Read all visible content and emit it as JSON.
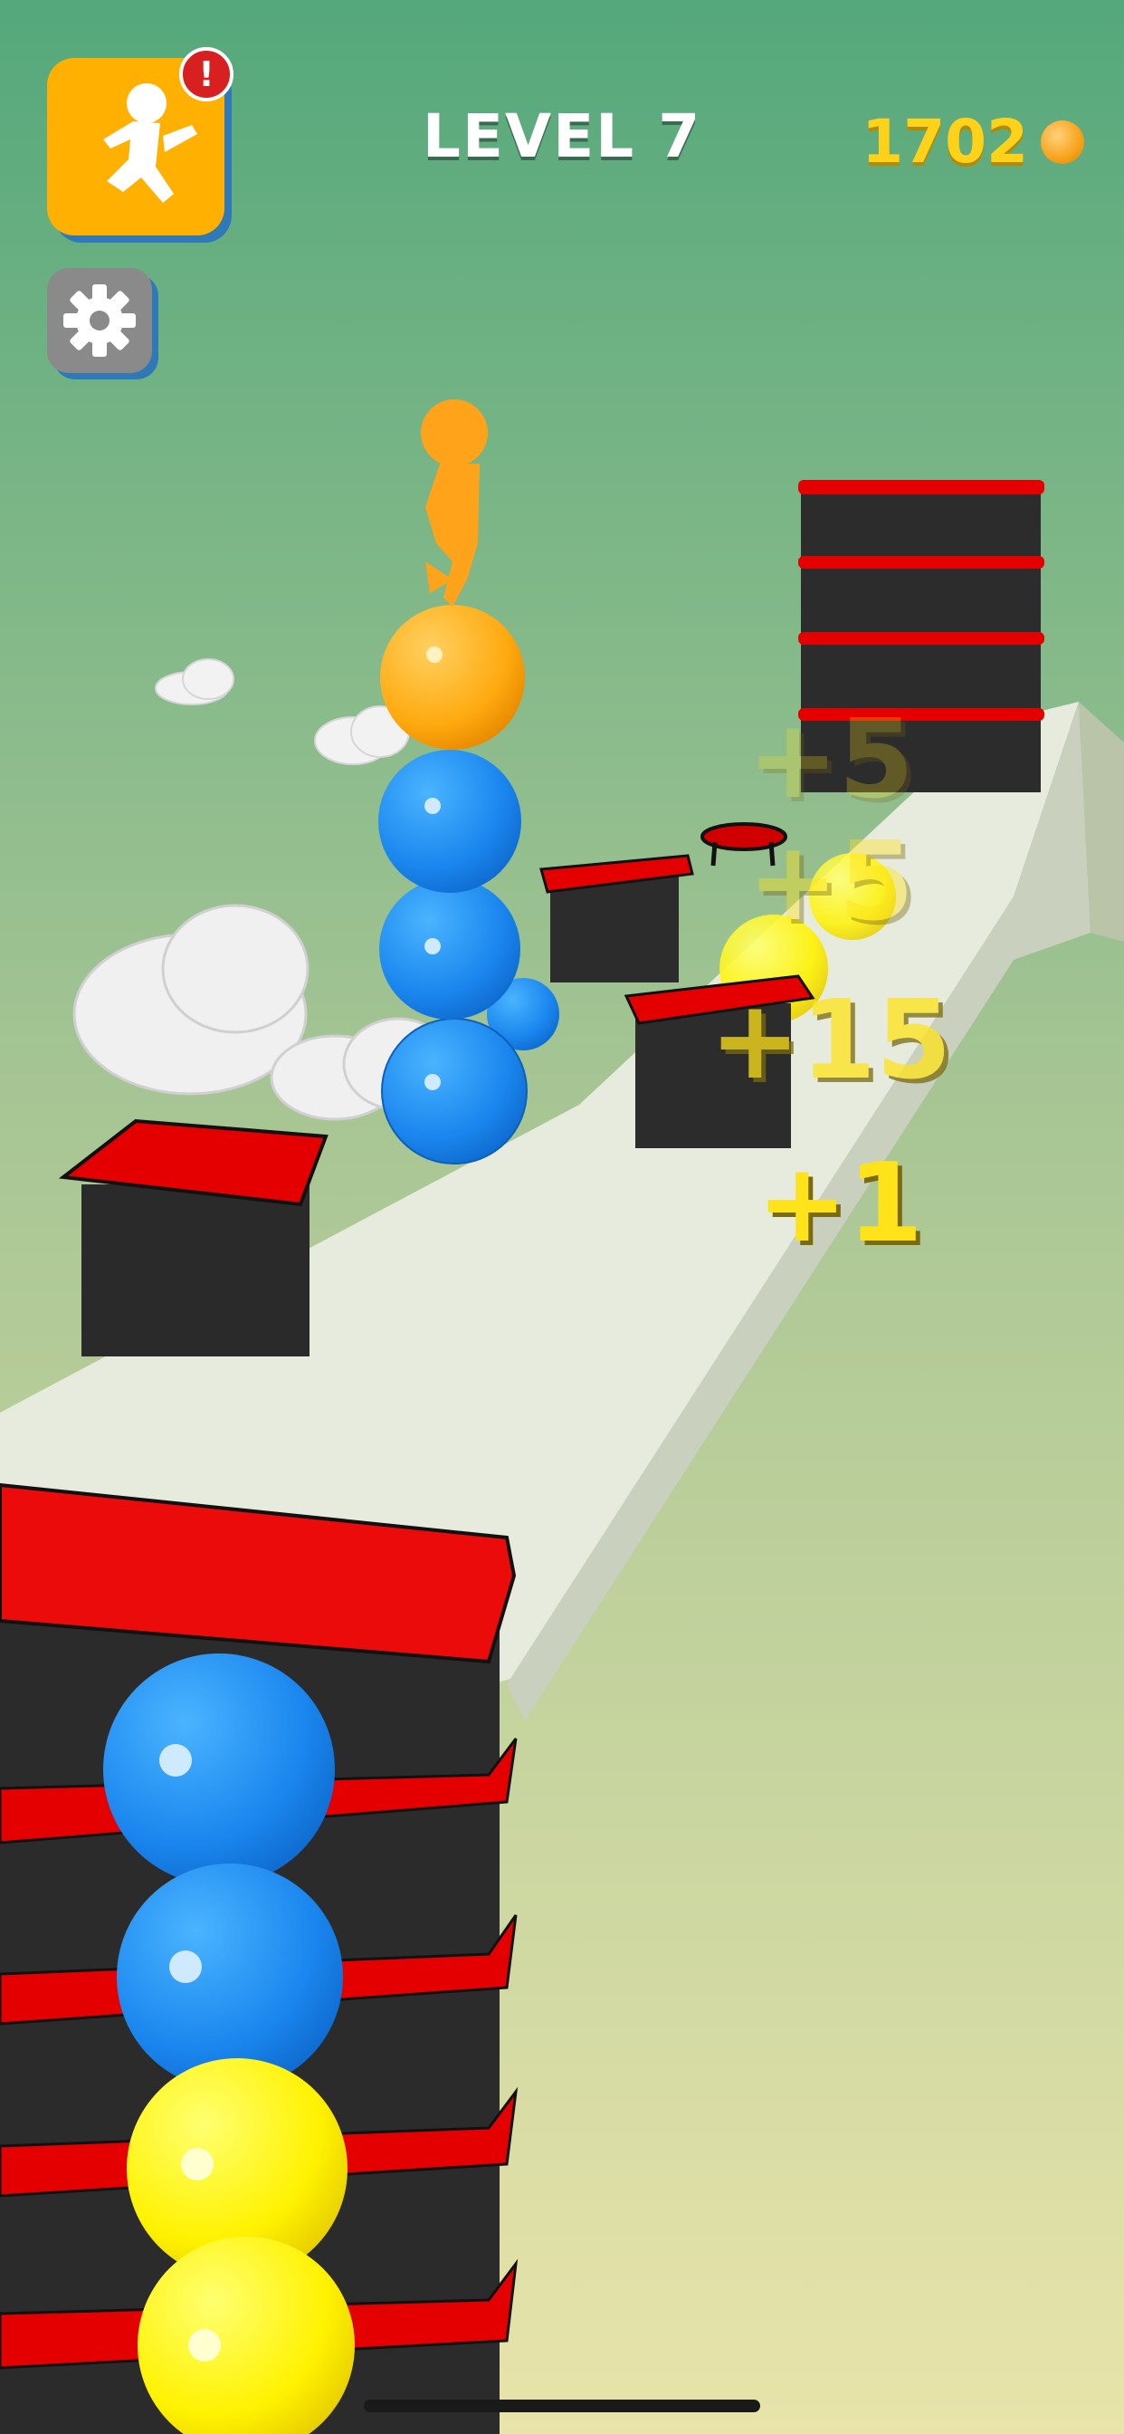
{
  "hud": {
    "level_label": "LEVEL 7",
    "coin_count": "1702",
    "notification_badge": "!"
  },
  "popups": {
    "p1": "+5",
    "p2": "+5",
    "p3": "+15",
    "p4": "+1"
  },
  "colors": {
    "sky_top": "#55aa7c",
    "sky_bottom": "#e5e2a8",
    "accent_orange": "#ffb000",
    "block_red": "#e40000",
    "ball_blue": "#1e90f0",
    "ball_yellow": "#ffef00"
  },
  "icons": {
    "character": "running-character-icon",
    "settings": "gear-icon",
    "coin": "coin-icon"
  }
}
